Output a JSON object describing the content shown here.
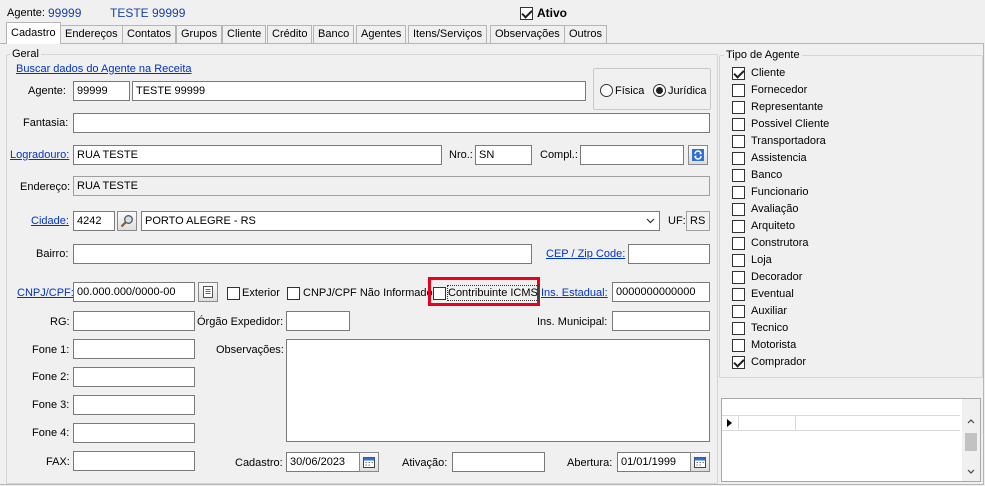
{
  "header": {
    "agent_label": "Agente:",
    "agent_code": "99999",
    "agent_name": "TESTE 99999",
    "active_label": "Ativo",
    "active_checked": true
  },
  "tabs": [
    {
      "label": "Cadastro",
      "active": true
    },
    {
      "label": "Endereços"
    },
    {
      "label": "Contatos"
    },
    {
      "label": "Grupos"
    },
    {
      "label": "Cliente"
    },
    {
      "label": "Crédito"
    },
    {
      "label": "Banco"
    },
    {
      "label": "Agentes"
    },
    {
      "label": "Itens/Serviços"
    },
    {
      "label": "Observações"
    },
    {
      "label": "Outros"
    }
  ],
  "geral": {
    "group_title": "Geral",
    "buscar_link": "Buscar dados do Agente na Receita",
    "agente_label": "Agente:",
    "agente_code": "99999",
    "agente_name": "TESTE 99999",
    "fisica_label": "Física",
    "juridica_label": "Jurídica",
    "person_type": "Jurídica",
    "fantasia_label": "Fantasia:",
    "fantasia_value": "",
    "logradouro_label": "Logradouro:",
    "logradouro_value": "RUA TESTE",
    "nro_label": "Nro.:",
    "nro_value": "SN",
    "compl_label": "Compl.:",
    "compl_value": "",
    "endereco_label": "Endereço:",
    "endereco_value": "RUA TESTE",
    "cidade_label": "Cidade:",
    "cidade_code": "4242",
    "cidade_name": "PORTO ALEGRE - RS",
    "uf_label": "UF:",
    "uf_value": "RS",
    "bairro_label": "Bairro:",
    "bairro_value": "",
    "cep_label": "CEP / Zip Code:",
    "cep_value": "",
    "cnpj_label": "CNPJ/CPF:",
    "cnpj_value": "00.000.000/0000-00",
    "exterior_label": "Exterior",
    "cnpj_nao_informado_label": "CNPJ/CPF Não Informado",
    "contribuinte_label": "Contribuinte ICMS",
    "ins_estadual_label": "Ins. Estadual:",
    "ins_estadual_value": "0000000000000",
    "rg_label": "RG:",
    "rg_value": "",
    "orgao_label": "Órgão Expedidor:",
    "orgao_value": "",
    "ins_municipal_label": "Ins. Municipal:",
    "ins_municipal_value": "",
    "fone1_label": "Fone 1:",
    "fone2_label": "Fone 2:",
    "fone3_label": "Fone 3:",
    "fone4_label": "Fone 4:",
    "fax_label": "FAX:",
    "observacoes_label": "Observações:",
    "cadastro_label": "Cadastro:",
    "cadastro_value": "30/06/2023",
    "ativacao_label": "Ativação:",
    "ativacao_value": "",
    "abertura_label": "Abertura:",
    "abertura_value": "01/01/1999"
  },
  "tipo_agente": {
    "group_title": "Tipo de Agente",
    "items": [
      {
        "label": "Cliente",
        "checked": true
      },
      {
        "label": "Fornecedor",
        "checked": false
      },
      {
        "label": "Representante",
        "checked": false
      },
      {
        "label": "Possivel Cliente",
        "checked": false
      },
      {
        "label": "Transportadora",
        "checked": false
      },
      {
        "label": "Assistencia",
        "checked": false
      },
      {
        "label": "Banco",
        "checked": false
      },
      {
        "label": "Funcionario",
        "checked": false
      },
      {
        "label": "Avaliação",
        "checked": false
      },
      {
        "label": "Arquiteto",
        "checked": false
      },
      {
        "label": "Construtora",
        "checked": false
      },
      {
        "label": "Loja",
        "checked": false
      },
      {
        "label": "Decorador",
        "checked": false
      },
      {
        "label": "Eventual",
        "checked": false
      },
      {
        "label": "Auxiliar",
        "checked": false
      },
      {
        "label": "Tecnico",
        "checked": false
      },
      {
        "label": "Motorista",
        "checked": false
      },
      {
        "label": "Comprador",
        "checked": true
      }
    ]
  },
  "colors": {
    "link": "#0033cc",
    "highlight": "#e8001c",
    "header_text": "#1a3fa8"
  },
  "icons": {
    "search": "magnifier-icon",
    "refresh": "refresh-icon",
    "document": "document-icon",
    "calendar": "calendar-icon",
    "dropdown": "chevron-down-icon"
  }
}
